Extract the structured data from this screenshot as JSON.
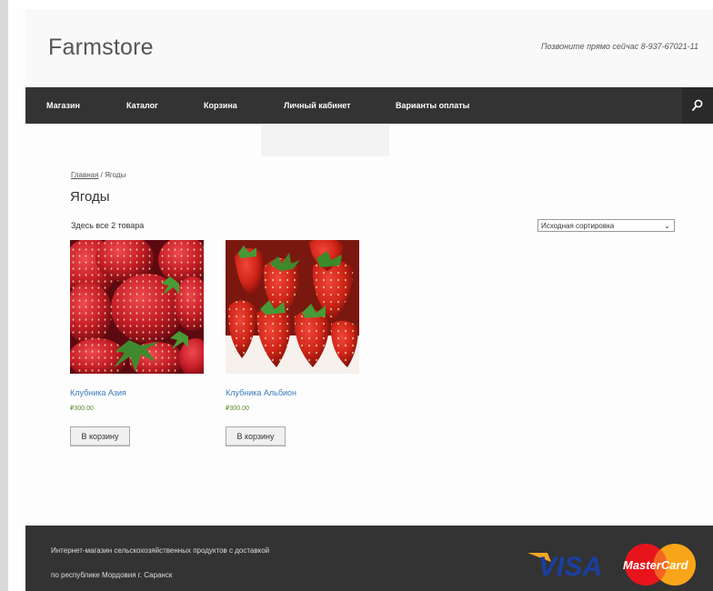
{
  "header": {
    "site_title": "Farmstore",
    "phone": "Позвоните прямо сейчас 8-937-67021-11"
  },
  "nav": {
    "items": [
      "Магазин",
      "Каталог",
      "Корзина",
      "Личный кабинет",
      "Варианты оплаты"
    ],
    "search_icon": "search-icon"
  },
  "breadcrumb": {
    "home": "Главная",
    "separator": " / ",
    "current": "Ягоды"
  },
  "page_title": "Ягоды",
  "result_count": "Здесь все 2 товара",
  "sort": {
    "selected": "Исходная сортировка"
  },
  "products": [
    {
      "name": "Клубника Азия",
      "price": "₽300.00",
      "button": "В корзину"
    },
    {
      "name": "Клубника Альбион",
      "price": "₽300.00",
      "button": "В корзину"
    }
  ],
  "footer": {
    "line1": "Интернет-магазин сельскохозяйственных продуктов с доставкой",
    "line2": "по республике Мордовия г. Саранск",
    "visa": "VISA",
    "mastercard": "MasterCard"
  },
  "colors": {
    "nav_bg": "#333333",
    "link": "#3a7bbf",
    "price": "#5a8a2a",
    "strawberry": "#c8202a"
  }
}
